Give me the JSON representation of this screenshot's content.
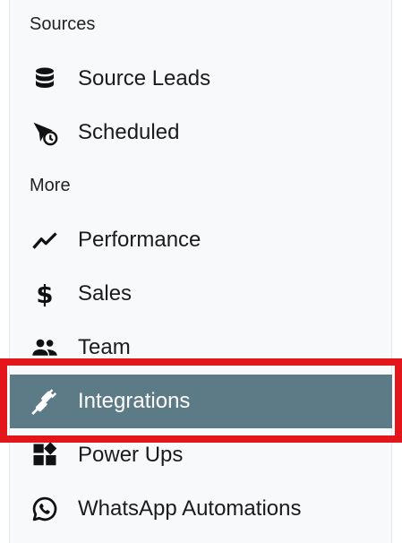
{
  "sidebar": {
    "sections": [
      {
        "label": "Sources"
      },
      {
        "label": "More"
      }
    ],
    "items": [
      {
        "label": "Source Leads",
        "icon": "database-icon"
      },
      {
        "label": "Scheduled",
        "icon": "scheduled-send-icon"
      },
      {
        "label": "Performance",
        "icon": "trend-line-icon"
      },
      {
        "label": "Sales",
        "icon": "dollar-icon"
      },
      {
        "label": "Team",
        "icon": "team-icon"
      },
      {
        "label": "Integrations",
        "icon": "plug-icon",
        "active": true
      },
      {
        "label": "Power Ups",
        "icon": "widgets-icon"
      },
      {
        "label": "WhatsApp Automations",
        "icon": "whatsapp-icon"
      }
    ]
  },
  "colors": {
    "active_bg": "#5c7b87",
    "highlight_border": "#e3161b",
    "sidebar_bg": "#f8f9fb"
  }
}
